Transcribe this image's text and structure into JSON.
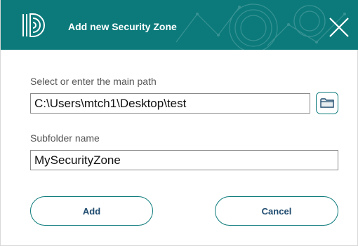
{
  "window": {
    "title": "Add new Security Zone",
    "accent_color": "#0c7a7b",
    "logo_icon": "app-logo-icon",
    "close_icon": "close-icon"
  },
  "main_path": {
    "label": "Select or enter the main path",
    "value": "C:\\Users\\mtch1\\Desktop\\test",
    "browse_icon": "folder-icon"
  },
  "subfolder": {
    "label": "Subfolder name",
    "value": "MySecurityZone"
  },
  "buttons": {
    "add_label": "Add",
    "cancel_label": "Cancel"
  }
}
